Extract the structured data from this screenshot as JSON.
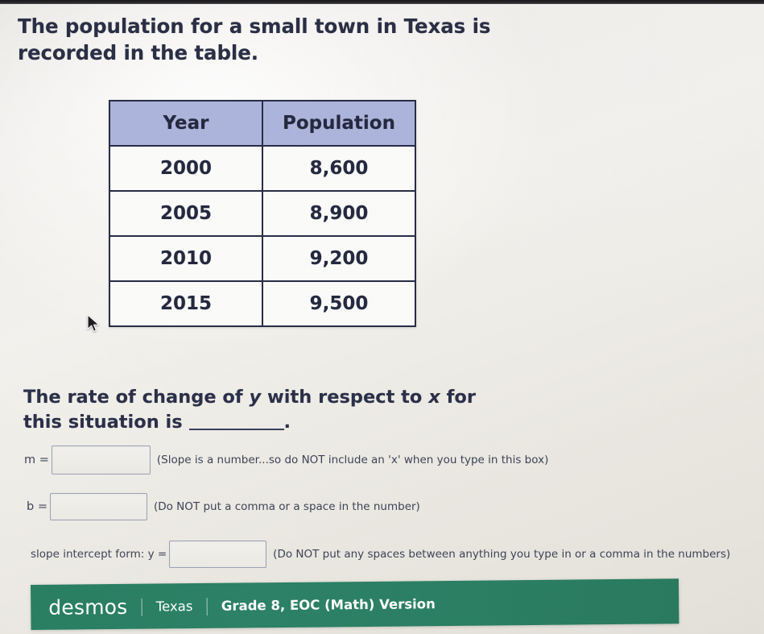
{
  "prompt": {
    "text": "The population for a small town in Texas is recorded in the table."
  },
  "table": {
    "columns": [
      "Year",
      "Population"
    ],
    "rows": [
      [
        "2000",
        "8,600"
      ],
      [
        "2005",
        "8,900"
      ],
      [
        "2010",
        "9,200"
      ],
      [
        "2015",
        "9,500"
      ]
    ]
  },
  "question": {
    "part1": "The rate of change of ",
    "var_y": "y",
    "part2": " with respect to ",
    "var_x": "x",
    "part3": " for this situation is ",
    "period": "."
  },
  "answers": {
    "m": {
      "label": "m =",
      "value": "",
      "placeholder": "",
      "hint": "(Slope is a number...so do NOT include an 'x' when you type in this box)"
    },
    "b": {
      "label": "b =",
      "value": "",
      "placeholder": "",
      "hint": "(Do NOT put a comma or a space in the number)"
    },
    "slope_intercept": {
      "label": "slope intercept form:  y =",
      "value": "",
      "placeholder": "",
      "hint": "(Do NOT put any spaces between anything you type in or a comma in the numbers)"
    }
  },
  "footer": {
    "brand": "desmos",
    "divider": "|",
    "region": "Texas",
    "version": "Grade 8, EOC (Math) Version"
  },
  "colors": {
    "table_header_bg": "#aeb5dc",
    "table_border": "#272d46",
    "text": "#2a2f45",
    "footer_green": "#2a7f62",
    "input_border": "#9aa2b4"
  },
  "chart_data": {
    "type": "table",
    "title": "Population of a small town in Texas",
    "xlabel": "Year",
    "ylabel": "Population",
    "categories": [
      2000,
      2005,
      2010,
      2015
    ],
    "values": [
      8600,
      8900,
      9200,
      9500
    ],
    "series": [
      {
        "name": "Population",
        "values": [
          8600,
          8900,
          9200,
          9500
        ]
      }
    ],
    "grid": false,
    "legend": "none"
  }
}
